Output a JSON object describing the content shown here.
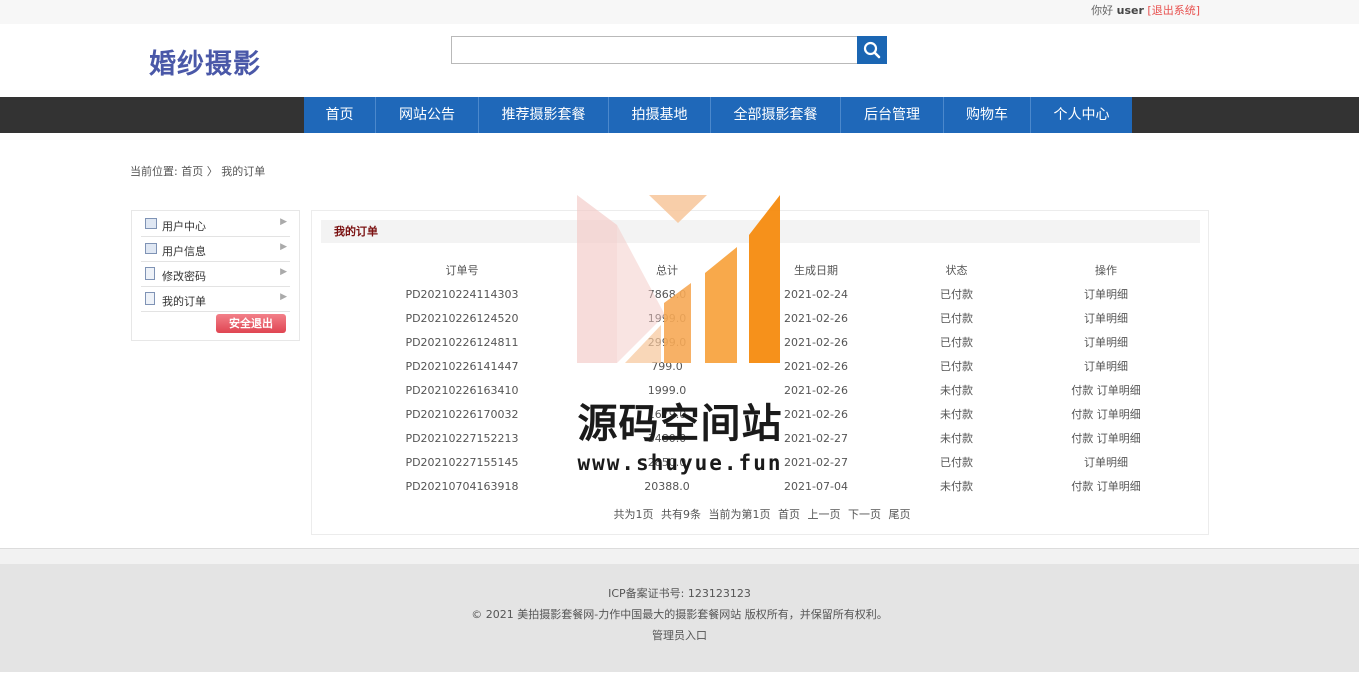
{
  "topbar": {
    "greeting": "你好",
    "username": "user",
    "logout": "[退出系统]"
  },
  "header": {
    "logo": "婚纱摄影",
    "search": {
      "value": "",
      "placeholder": ""
    }
  },
  "nav": {
    "items": [
      {
        "label": "首页"
      },
      {
        "label": "网站公告"
      },
      {
        "label": "推荐摄影套餐"
      },
      {
        "label": "拍摄基地"
      },
      {
        "label": "全部摄影套餐"
      },
      {
        "label": "后台管理"
      },
      {
        "label": "购物车"
      },
      {
        "label": "个人中心"
      }
    ]
  },
  "breadcrumb": {
    "prefix": "当前位置:",
    "home": "首页",
    "sep": "〉",
    "current": "我的订单"
  },
  "sidebar": {
    "items": [
      {
        "label": "用户中心",
        "icon": "user-card-icon"
      },
      {
        "label": "用户信息",
        "icon": "user-card-icon"
      },
      {
        "label": "修改密码",
        "icon": "document-icon"
      },
      {
        "label": "我的订单",
        "icon": "document-icon"
      }
    ],
    "logout_button": "安全退出"
  },
  "main": {
    "title": "我的订单",
    "columns": [
      "订单号",
      "总计",
      "生成日期",
      "状态",
      "操作"
    ],
    "rows": [
      {
        "id": "PD20210224114303",
        "total": "7868.0",
        "date": "2021-02-24",
        "status": "已付款",
        "pay": "",
        "detail": "订单明细"
      },
      {
        "id": "PD20210226124520",
        "total": "1999.0",
        "date": "2021-02-26",
        "status": "已付款",
        "pay": "",
        "detail": "订单明细"
      },
      {
        "id": "PD20210226124811",
        "total": "2999.0",
        "date": "2021-02-26",
        "status": "已付款",
        "pay": "",
        "detail": "订单明细"
      },
      {
        "id": "PD20210226141447",
        "total": "799.0",
        "date": "2021-02-26",
        "status": "已付款",
        "pay": "",
        "detail": "订单明细"
      },
      {
        "id": "PD20210226163410",
        "total": "1999.0",
        "date": "2021-02-26",
        "status": "未付款",
        "pay": "付款",
        "detail": "订单明细"
      },
      {
        "id": "PD20210226170032",
        "total": "1679.0",
        "date": "2021-02-26",
        "status": "未付款",
        "pay": "付款",
        "detail": "订单明细"
      },
      {
        "id": "PD20210227152213",
        "total": "3480.0",
        "date": "2021-02-27",
        "status": "未付款",
        "pay": "付款",
        "detail": "订单明细"
      },
      {
        "id": "PD20210227155145",
        "total": "2850.0",
        "date": "2021-02-27",
        "status": "已付款",
        "pay": "",
        "detail": "订单明细"
      },
      {
        "id": "PD20210704163918",
        "total": "20388.0",
        "date": "2021-07-04",
        "status": "未付款",
        "pay": "付款",
        "detail": "订单明细"
      }
    ],
    "pager": {
      "pages": "共为1页",
      "count": "共有9条",
      "current": "当前为第1页",
      "first": "首页",
      "prev": "上一页",
      "next": "下一页",
      "last": "尾页"
    }
  },
  "watermark": {
    "title": "源码空间站",
    "url": "www.shuyue.fun"
  },
  "footer": {
    "icp": "ICP备案证书号:  123123123",
    "copyright": "© 2021 美拍摄影套餐网-力作中国最大的摄影套餐网站 版权所有，并保留所有权利。",
    "admin": "管理员入口"
  },
  "colors": {
    "nav_blue": "#1f68b9",
    "nav_dark": "#333333",
    "logo": "#4a58a8",
    "title_red": "#7a1010",
    "logout_red": "#e8514f"
  }
}
